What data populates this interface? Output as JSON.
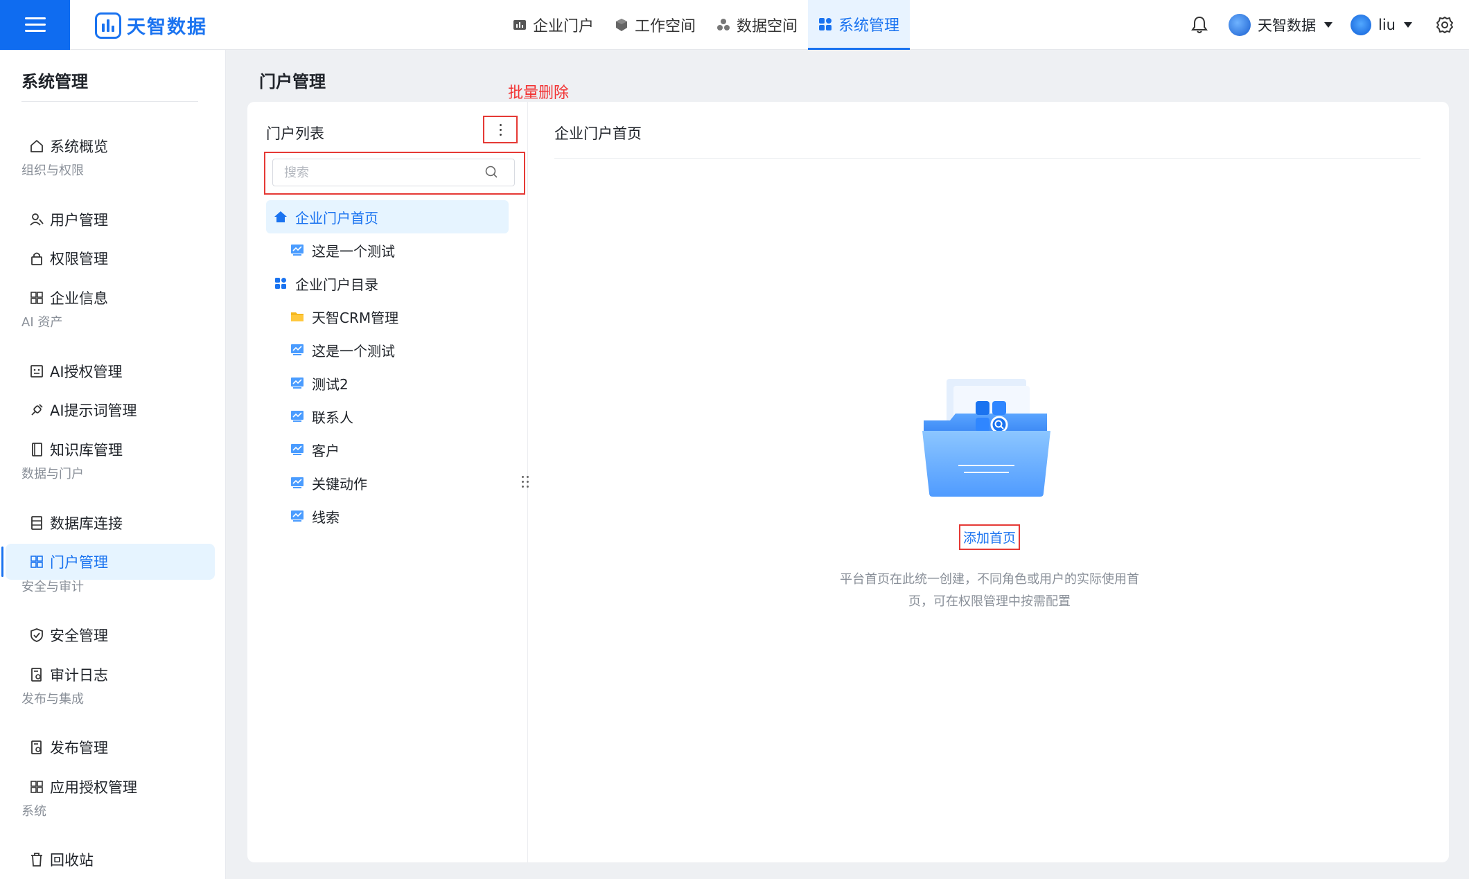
{
  "app": {
    "logo_text": "天智数据",
    "accent": "#1a73f0",
    "annotation_color": "#e53935"
  },
  "topnav": [
    {
      "label": "企业门户",
      "icon": "bar-chart-icon"
    },
    {
      "label": "工作空间",
      "icon": "cube-icon"
    },
    {
      "label": "数据空间",
      "icon": "cubes-icon"
    },
    {
      "label": "系统管理",
      "icon": "grid-icon",
      "active": true
    }
  ],
  "topright": {
    "org_name": "天智数据",
    "user_name": "liu"
  },
  "sidebar": {
    "title": "系统管理",
    "overview": "系统概览",
    "groups": {
      "org": "组织与权限",
      "ai": "AI 资产",
      "data": "数据与门户",
      "security": "安全与审计",
      "publish": "发布与集成",
      "system": "系统"
    },
    "items": {
      "users": "用户管理",
      "permissions": "权限管理",
      "company": "企业信息",
      "ai_auth": "AI授权管理",
      "ai_prompt": "AI提示词管理",
      "knowledge": "知识库管理",
      "db_conn": "数据库连接",
      "portal": "门户管理",
      "security": "安全管理",
      "audit": "审计日志",
      "release": "发布管理",
      "app_auth": "应用授权管理",
      "recycle": "回收站"
    }
  },
  "main": {
    "page_title": "门户管理",
    "annotation_bulk_delete": "批量删除",
    "left_panel": {
      "title": "门户列表",
      "search_placeholder": "搜索",
      "tree": [
        {
          "label": "企业门户首页",
          "icon": "home-icon",
          "level": 0,
          "active": true
        },
        {
          "label": "这是一个测试",
          "icon": "dashboard-icon",
          "level": 1
        },
        {
          "label": "企业门户目录",
          "icon": "grid-icon",
          "level": 0
        },
        {
          "label": "天智CRM管理",
          "icon": "folder-icon",
          "level": 1
        },
        {
          "label": "这是一个测试",
          "icon": "dashboard-icon",
          "level": 1
        },
        {
          "label": "测试2",
          "icon": "dashboard-icon",
          "level": 1
        },
        {
          "label": "联系人",
          "icon": "dashboard-icon",
          "level": 1
        },
        {
          "label": "客户",
          "icon": "dashboard-icon",
          "level": 1
        },
        {
          "label": "关键动作",
          "icon": "dashboard-icon",
          "level": 1
        },
        {
          "label": "线索",
          "icon": "dashboard-icon",
          "level": 1
        }
      ]
    },
    "right_panel": {
      "title": "企业门户首页",
      "add_home_label": "添加首页",
      "empty_desc_line1": "平台首页在此统一创建，不同角色或用户的实际使用首",
      "empty_desc_line2": "页，可在权限管理中按需配置"
    }
  }
}
